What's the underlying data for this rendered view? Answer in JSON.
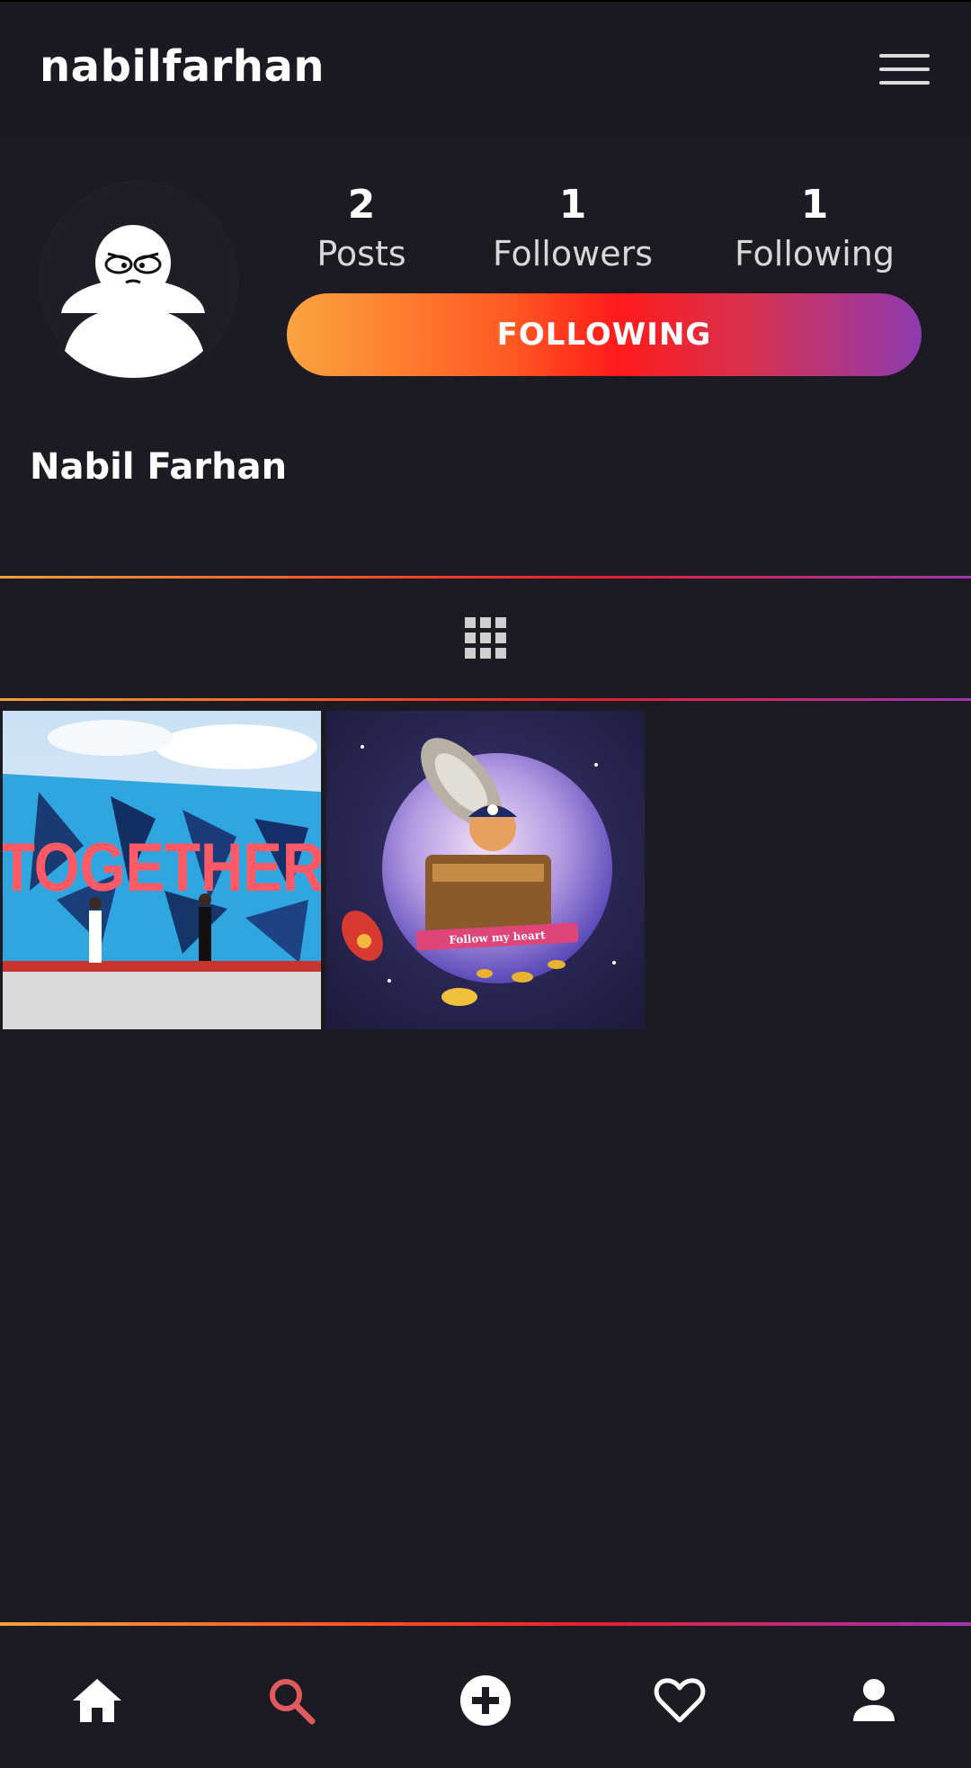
{
  "header": {
    "username": "nabilfarhan"
  },
  "icons": {
    "menu": "menu-icon",
    "avatar": "default-avatar-icon",
    "grid": "grid-icon",
    "home": "home-icon",
    "search": "search-icon",
    "add": "add-circle-icon",
    "activity": "heart-icon",
    "profile": "person-icon"
  },
  "profile": {
    "display_name": "Nabil Farhan",
    "stats": [
      {
        "value": "2",
        "label": "Posts"
      },
      {
        "value": "1",
        "label": "Followers"
      },
      {
        "value": "1",
        "label": "Following"
      }
    ],
    "follow_button": "FOLLOWING"
  },
  "posts": [
    {
      "text": "TOGETHER"
    },
    {
      "text": "Follow my heart"
    }
  ],
  "colors": {
    "background": "#1c1b24",
    "header_bg": "#1a1a22",
    "gradient_start": "#fca440",
    "gradient_mid": "#ff1b1b",
    "gradient_end": "#8f3bb0",
    "active_nav": "#e05a5e"
  },
  "nav": {
    "active": "search"
  }
}
